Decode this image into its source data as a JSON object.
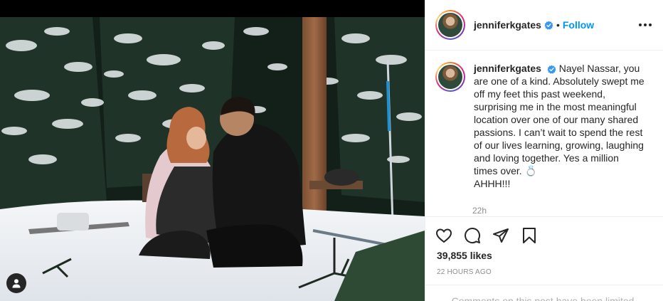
{
  "post": {
    "username": "jenniferkgates",
    "follow_label": "Follow",
    "separator": "•",
    "caption": "Nayel Nassar, you are one of a kind. Absolutely swept me off my feet this past weekend, surprising me in the most meaningful location over one of our many shared passions. I can’t wait to spend the rest of our lives learning, growing, laughing and loving together. Yes a million times over. 💍\nAHHH!!!",
    "relative_time": "22h",
    "likes": "39,855 likes",
    "posted_time": "22 HOURS AGO",
    "comments_notice": "Comments on this post have been limited."
  },
  "icons": {
    "verified": "verified-badge-icon",
    "more": "more-options-icon",
    "like": "heart-icon",
    "comment": "comment-icon",
    "share": "share-icon",
    "save": "bookmark-icon",
    "user_tag": "user-tag-icon"
  },
  "colors": {
    "accent": "#0095f6",
    "verified": "#3897f0",
    "text": "#262626",
    "muted": "#8e8e8e"
  }
}
